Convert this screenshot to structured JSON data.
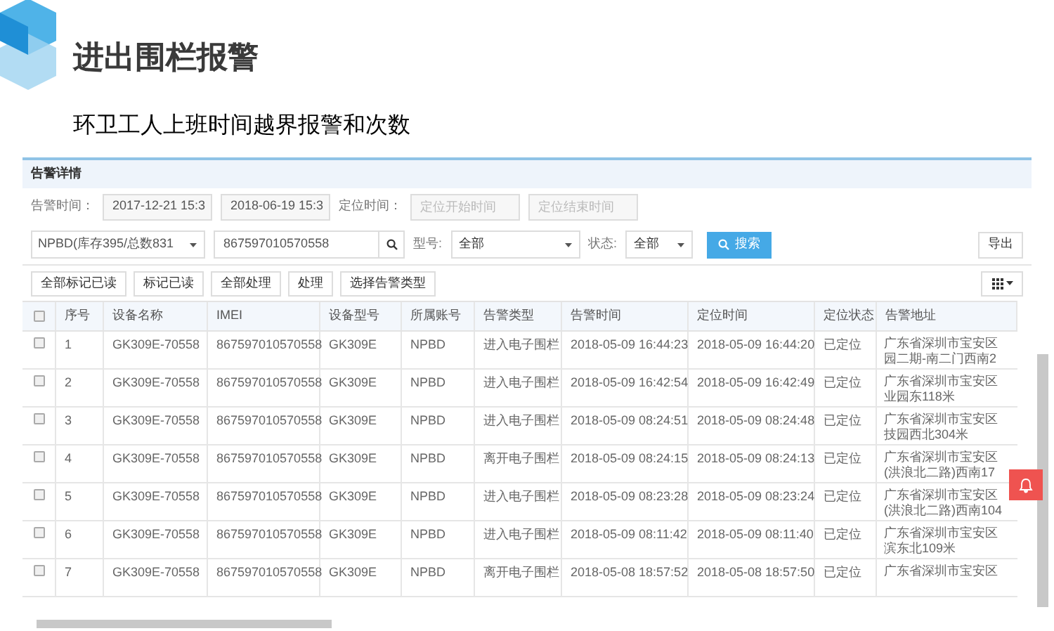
{
  "slide": {
    "title": "进出围栏报警",
    "subtitle": "环卫工人上班时间越界报警和次数"
  },
  "panel": {
    "title": "告警详情"
  },
  "filters": {
    "alarm_time_label": "告警时间：",
    "alarm_start": "2017-12-21 15:3",
    "alarm_end": "2018-06-19 15:3",
    "locate_time_label": "定位时间：",
    "locate_start_placeholder": "定位开始时间",
    "locate_end_placeholder": "定位结束时间",
    "account": "NPBD(库存395/总数831",
    "imei": "867597010570558",
    "model_label": "型号:",
    "model": "全部",
    "state_label": "状态:",
    "state": "全部",
    "search_button": "搜索",
    "export_button": "导出"
  },
  "actions": [
    "全部标记已读",
    "标记已读",
    "全部处理",
    "处理",
    "选择告警类型"
  ],
  "table": {
    "columns": [
      "序号",
      "设备名称",
      "IMEI",
      "设备型号",
      "所属账号",
      "告警类型",
      "告警时间",
      "定位时间",
      "定位状态",
      "告警地址"
    ],
    "header_checked": false,
    "rows": [
      {
        "checked": false,
        "cells": [
          "1",
          "GK309E-70558",
          "867597010570558",
          "GK309E",
          "NPBD",
          "进入电子围栏",
          "2018-05-09 16:44:23",
          "2018-05-09 16:44:20",
          "已定位"
        ],
        "address": [
          "广东省深圳市宝安区",
          "园二期-南二门西南2"
        ]
      },
      {
        "checked": false,
        "cells": [
          "2",
          "GK309E-70558",
          "867597010570558",
          "GK309E",
          "NPBD",
          "进入电子围栏",
          "2018-05-09 16:42:54",
          "2018-05-09 16:42:49",
          "已定位"
        ],
        "address": [
          "广东省深圳市宝安区",
          "业园东118米"
        ]
      },
      {
        "checked": false,
        "cells": [
          "3",
          "GK309E-70558",
          "867597010570558",
          "GK309E",
          "NPBD",
          "进入电子围栏",
          "2018-05-09 08:24:51",
          "2018-05-09 08:24:48",
          "已定位"
        ],
        "address": [
          "广东省深圳市宝安区",
          "技园西北304米"
        ]
      },
      {
        "checked": false,
        "cells": [
          "4",
          "GK309E-70558",
          "867597010570558",
          "GK309E",
          "NPBD",
          "离开电子围栏",
          "2018-05-09 08:24:15",
          "2018-05-09 08:24:13",
          "已定位"
        ],
        "address": [
          "广东省深圳市宝安区",
          "(洪浪北二路)西南17"
        ]
      },
      {
        "checked": false,
        "cells": [
          "5",
          "GK309E-70558",
          "867597010570558",
          "GK309E",
          "NPBD",
          "进入电子围栏",
          "2018-05-09 08:23:28",
          "2018-05-09 08:23:24",
          "已定位"
        ],
        "address": [
          "广东省深圳市宝安区",
          "(洪浪北二路)西南104"
        ]
      },
      {
        "checked": false,
        "cells": [
          "6",
          "GK309E-70558",
          "867597010570558",
          "GK309E",
          "NPBD",
          "进入电子围栏",
          "2018-05-09 08:11:42",
          "2018-05-09 08:11:40",
          "已定位"
        ],
        "address": [
          "广东省深圳市宝安区",
          "滨东北109米"
        ]
      },
      {
        "checked": false,
        "cells": [
          "7",
          "GK309E-70558",
          "867597010570558",
          "GK309E",
          "NPBD",
          "离开电子围栏",
          "2018-05-08 18:57:52",
          "2018-05-08 18:57:50",
          "已定位"
        ],
        "address": [
          "广东省深圳市宝安区"
        ]
      }
    ]
  }
}
